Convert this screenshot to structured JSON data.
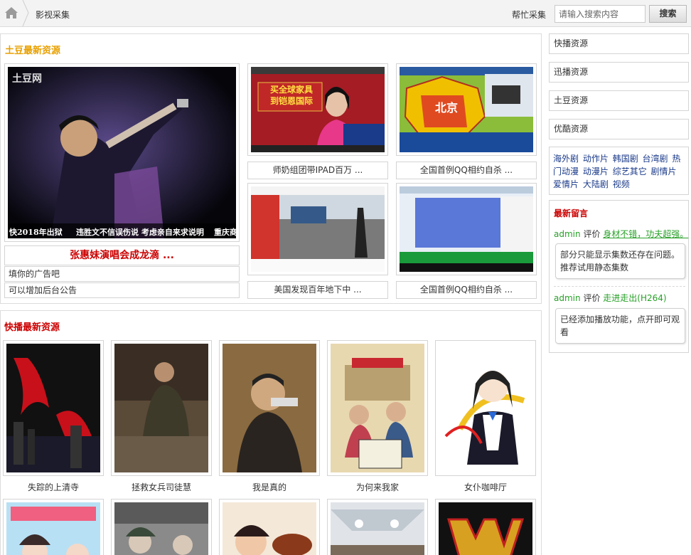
{
  "header": {
    "breadcrumb": "影视采集",
    "help_link": "帮忙采集",
    "search_placeholder": "请输入搜索内容",
    "search_button": "搜索"
  },
  "tudou": {
    "title": "土豆最新资源",
    "title_color": "#e8a000",
    "feature": {
      "title": "张惠妹演唱会成龙滴 ...",
      "image_watermark": "土豆网",
      "subtitle_left": "快2018年出狱",
      "subtitle_mid": "违胜文不信误伤说  考虑亲自来求说明",
      "subtitle_right": "重庆商"
    },
    "notices": [
      "填你的广告吧",
      "可以增加后台公告"
    ],
    "items": [
      {
        "caption": "师奶组团带IPAD百万 ...",
        "overlay": "买全球家具\n到铠恩国际"
      },
      {
        "caption": "全国首例QQ相约自杀 ...",
        "overlay": "北京"
      },
      {
        "caption": "美国发现百年地下中 ...",
        "overlay": ""
      },
      {
        "caption": "全国首例QQ相约自杀 ...",
        "overlay": ""
      }
    ]
  },
  "kuaibo": {
    "title": "快播最新资源",
    "title_color": "#cc0000",
    "row1": [
      {
        "caption": "失踪的上清寺"
      },
      {
        "caption": "拯救女兵司徒慧"
      },
      {
        "caption": "我是真的"
      },
      {
        "caption": "为何来我家"
      },
      {
        "caption": "女仆咖啡厅"
      }
    ]
  },
  "sidebar": {
    "links": [
      "快播资源",
      "迅播资源",
      "土豆资源",
      "优酷资源"
    ],
    "tags": [
      "海外剧",
      "动作片",
      "韩国剧",
      "台湾剧",
      "热门动漫",
      "动漫片",
      "综艺其它",
      "剧情片",
      "爱情片",
      "大陆剧",
      "视频"
    ],
    "comments_title": "最新留言",
    "comments": [
      {
        "user": "admin",
        "action": "评价",
        "target": "身材不错，功夫超强。",
        "body": "部分只能显示集数还存在问题。推荐试用静态集数"
      },
      {
        "user": "admin",
        "action": "评价",
        "target": "走进走出(H264)",
        "body": "已经添加播放功能，点开即可观看"
      }
    ]
  }
}
